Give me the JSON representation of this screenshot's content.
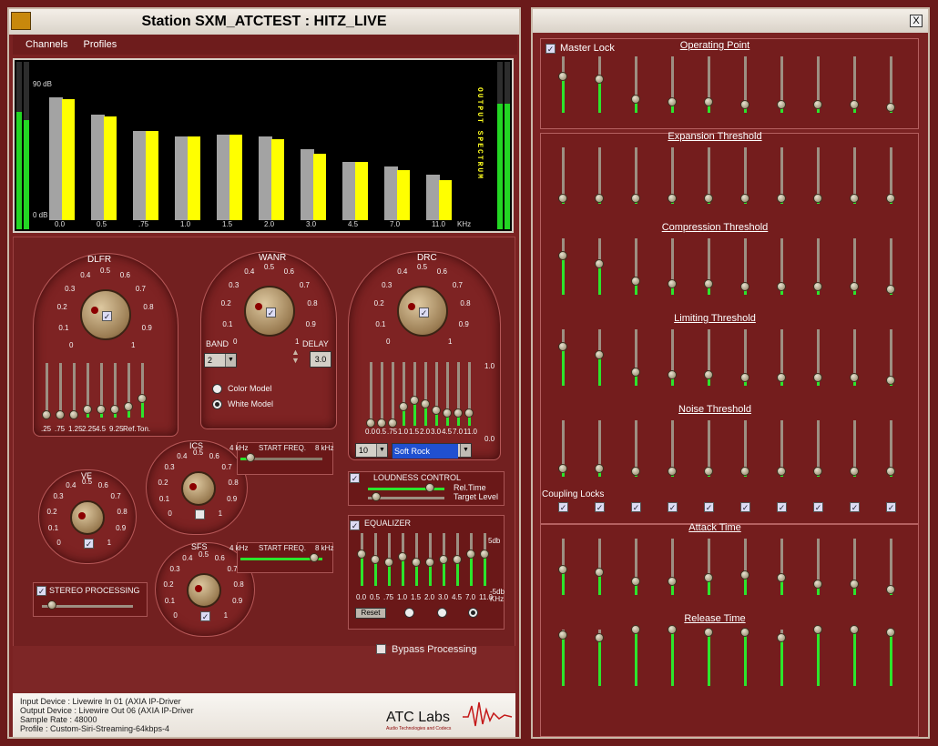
{
  "title": "Station  SXM_ATCTEST :  HITZ_LIVE",
  "menu": {
    "channels": "Channels",
    "profiles": "Profiles"
  },
  "spectrum": {
    "vertical_label": "OUTPUT SPECTRUM",
    "top_label": "90 dB",
    "bottom_label": "0 dB",
    "unit": "KHz",
    "freqs": [
      "0.0",
      "0.5",
      ".75",
      "1.0",
      "1.5",
      "2.0",
      "3.0",
      "4.5",
      "7.0",
      "11.0"
    ],
    "gray": [
      76,
      65,
      55,
      52,
      53,
      52,
      44,
      36,
      33,
      28
    ],
    "yellow": [
      75,
      64,
      55,
      52,
      53,
      50,
      41,
      36,
      31,
      25
    ]
  },
  "dlfr": {
    "title": "DLFR",
    "bands": [
      ".25",
      ".75",
      "1.25",
      "2.25",
      "4.5",
      "9.25",
      "Ref.",
      "Ton."
    ],
    "levels": [
      0.05,
      0.05,
      0.05,
      0.15,
      0.15,
      0.15,
      0.2,
      0.35
    ]
  },
  "wanr": {
    "title": "WANR",
    "band_label": "BAND",
    "band_value": "2",
    "delay_label": "DELAY",
    "delay_value": "3.0",
    "color_model": "Color Model",
    "white_model": "White Model"
  },
  "drc": {
    "title": "DRC",
    "preset_value": "10",
    "preset_name": "Soft Rock",
    "scale_top": "1.0",
    "scale_bot": "0.0",
    "bands": [
      "0.0",
      "0.5",
      ".75",
      "1.0",
      "1.5",
      "2.0",
      "3.0",
      "4.5",
      "7.0",
      "11.0"
    ],
    "levels": [
      0.05,
      0.05,
      0.05,
      0.3,
      0.4,
      0.35,
      0.25,
      0.2,
      0.2,
      0.2
    ]
  },
  "ics": {
    "title": "ICS",
    "freq_start": "4 kHz",
    "freq_label": "START FREQ.",
    "freq_end": "8 kHz"
  },
  "ve": {
    "title": "VE"
  },
  "sfs": {
    "title": "SFS",
    "freq_start": "4 kHz",
    "freq_label": "START FREQ.",
    "freq_end": "8 kHz"
  },
  "loudness": {
    "title": "LOUDNESS CONTROL",
    "rel_time": "Rel.Time",
    "target_level": "Target Level"
  },
  "equalizer": {
    "title": "EQUALIZER",
    "top": "5db",
    "bot": "-5db",
    "bands": [
      "0.0",
      "0.5",
      ".75",
      "1.0",
      "1.5",
      "2.0",
      "3.0",
      "4.5",
      "7.0",
      "11.0"
    ],
    "reset": "Reset",
    "unit": "KHz"
  },
  "stereo": {
    "title": "STEREO PROCESSING"
  },
  "bypass": {
    "label": "Bypass Processing"
  },
  "info": {
    "input": "Input Device : Livewire In 01 (AXIA IP-Driver",
    "output": "Output Device : Livewire Out 06 (AXIA IP-Driver",
    "rate": "Sample Rate : 48000",
    "profile": "Profile : Custom-Siri-Streaming-64kbps-4"
  },
  "brand": {
    "name": "ATC Labs",
    "tagline": "Audio Technologies and Codecs"
  },
  "dial_scale": [
    "0",
    "0.1",
    "0.2",
    "0.3",
    "0.4",
    "0.5",
    "0.6",
    "0.7",
    "0.8",
    "0.9",
    "1"
  ],
  "right": {
    "close": "X",
    "master_lock": "Master Lock",
    "coupling": "Coupling Locks",
    "sections": [
      {
        "title": "Operating Point",
        "levels": [
          0.65,
          0.6,
          0.25,
          0.2,
          0.2,
          0.15,
          0.15,
          0.15,
          0.15,
          0.1
        ]
      },
      {
        "title": "Expansion Threshold",
        "levels": [
          0.1,
          0.1,
          0.1,
          0.1,
          0.1,
          0.1,
          0.1,
          0.1,
          0.1,
          0.1
        ]
      },
      {
        "title": "Compression Threshold",
        "levels": [
          0.7,
          0.55,
          0.25,
          0.2,
          0.2,
          0.15,
          0.15,
          0.15,
          0.15,
          0.1
        ]
      },
      {
        "title": "Limiting Threshold",
        "levels": [
          0.7,
          0.55,
          0.25,
          0.2,
          0.2,
          0.15,
          0.15,
          0.15,
          0.15,
          0.1
        ]
      },
      {
        "title": "Noise Threshold",
        "levels": [
          0.15,
          0.15,
          0.1,
          0.1,
          0.1,
          0.1,
          0.1,
          0.1,
          0.1,
          0.1
        ]
      },
      {
        "title": "Attack Time",
        "levels": [
          0.45,
          0.4,
          0.25,
          0.25,
          0.3,
          0.35,
          0.3,
          0.2,
          0.2,
          0.1
        ]
      },
      {
        "title": "Release Time",
        "levels": [
          0.9,
          0.85,
          1.0,
          1.0,
          0.95,
          0.95,
          0.85,
          1.0,
          1.0,
          0.95
        ]
      }
    ]
  }
}
